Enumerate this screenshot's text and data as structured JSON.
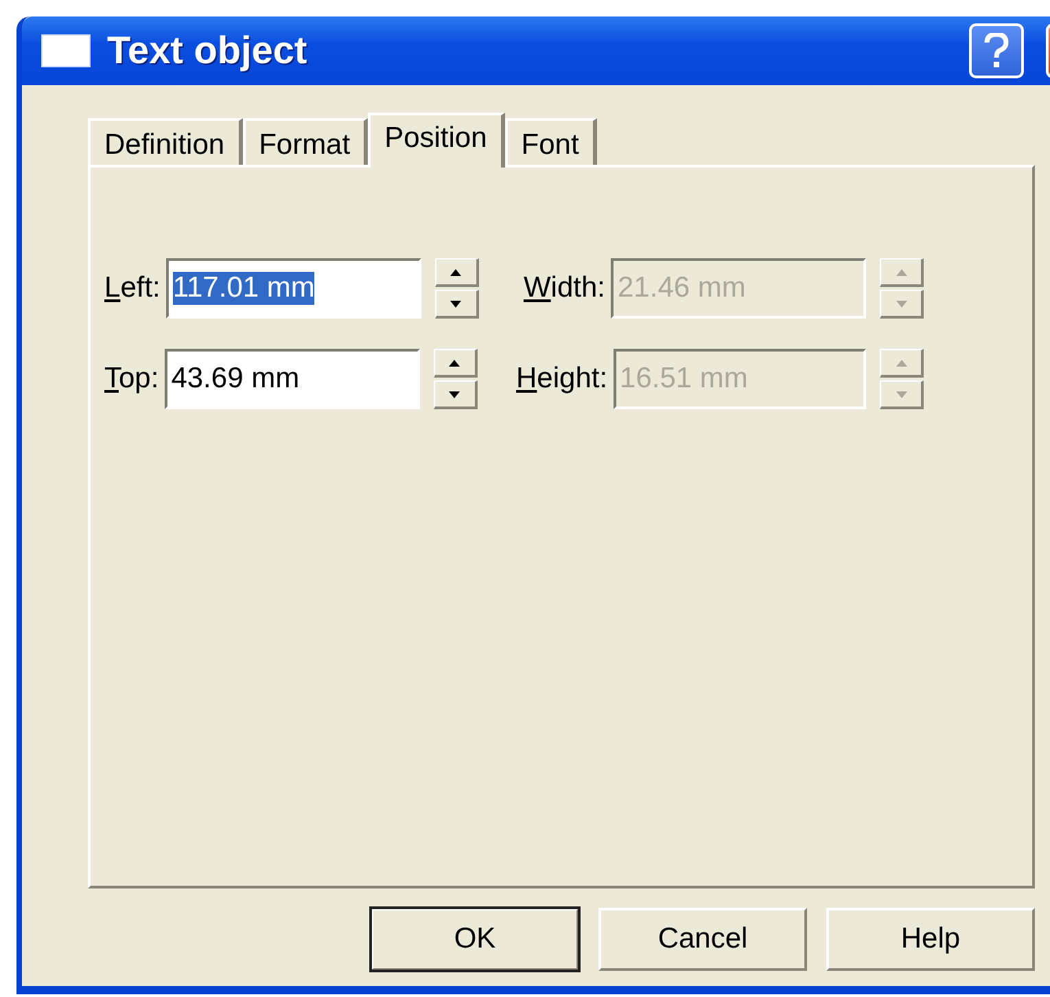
{
  "window": {
    "title": "Text object"
  },
  "tabs": [
    {
      "label": "Definition",
      "selected": false
    },
    {
      "label": "Format",
      "selected": false
    },
    {
      "label": "Position",
      "selected": true
    },
    {
      "label": "Font",
      "selected": false
    }
  ],
  "fields": [
    {
      "label": "Left:",
      "value": "117.01 mm",
      "disabled": false,
      "text_selected": true
    },
    {
      "label": "Width:",
      "value": "21.46 mm",
      "disabled": true,
      "text_selected": false
    },
    {
      "label": "Top:",
      "value": "43.69 mm",
      "disabled": false,
      "text_selected": false
    },
    {
      "label": "Height:",
      "value": "16.51 mm",
      "disabled": true,
      "text_selected": false
    }
  ],
  "buttons": [
    {
      "label": "OK",
      "default": true
    },
    {
      "label": "Cancel",
      "default": false
    },
    {
      "label": "Help",
      "default": false
    }
  ]
}
